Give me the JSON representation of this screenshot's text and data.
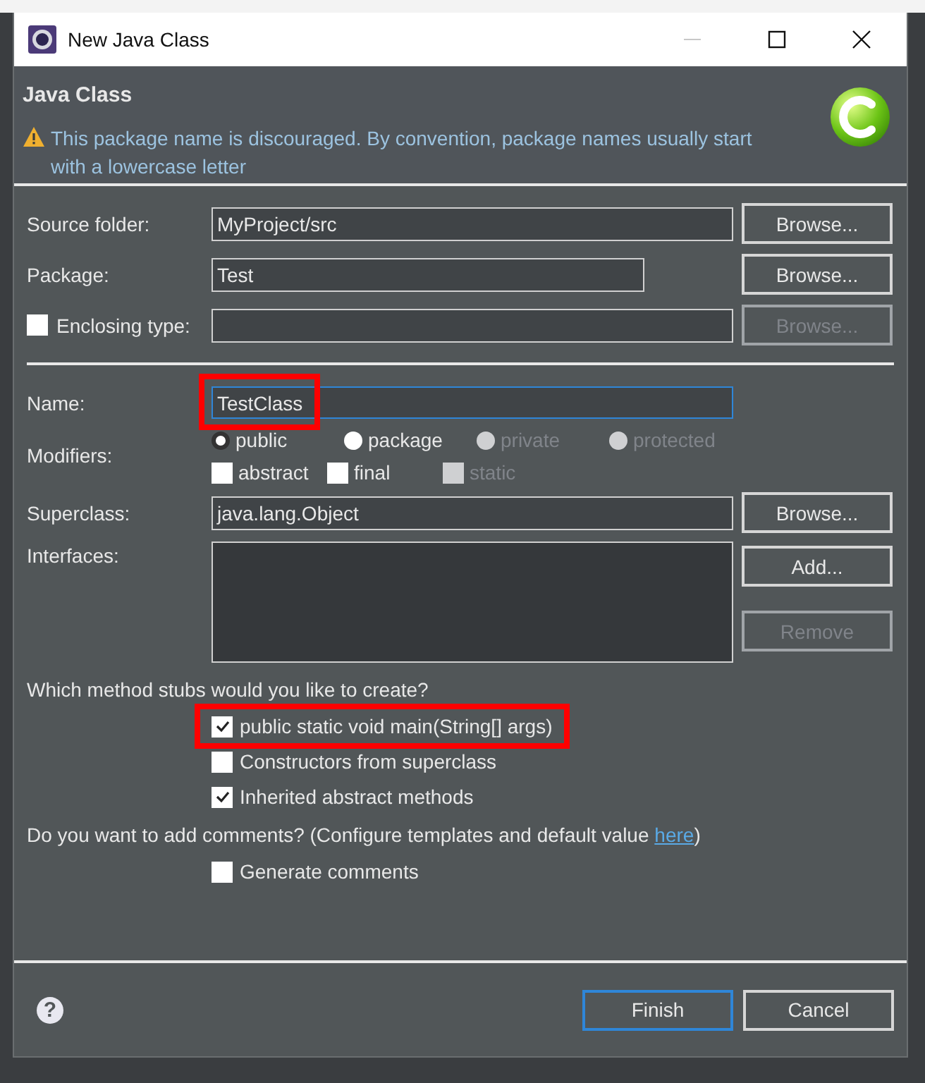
{
  "window": {
    "title": "New Java Class"
  },
  "header": {
    "title": "Java Class",
    "message": {
      "kind": "warning",
      "text": "This package name is discouraged. By convention, package names usually start with a lowercase letter"
    }
  },
  "top_fields": [
    {
      "kind": "text",
      "label": "Source folder:",
      "value": "MyProject/src",
      "button": {
        "label": "Browse...",
        "disabled": false
      }
    },
    {
      "kind": "short",
      "label": "Package:",
      "value": "Test",
      "button": {
        "label": "Browse...",
        "disabled": false
      }
    },
    {
      "kind": "checkbox",
      "label": "Enclosing type:",
      "checked": false,
      "button": {
        "label": "Browse...",
        "disabled": true
      }
    }
  ],
  "name": {
    "label": "Name:",
    "value": "TestClass",
    "highlighted": true
  },
  "modifiers": {
    "label": "Modifiers:",
    "radios": [
      {
        "label": "public",
        "selected": true,
        "disabled": false
      },
      {
        "label": "package",
        "selected": false,
        "disabled": false
      },
      {
        "label": "private",
        "selected": false,
        "disabled": true
      },
      {
        "label": "protected",
        "selected": false,
        "disabled": true
      }
    ],
    "checkboxes": [
      {
        "label": "abstract",
        "checked": false,
        "disabled": false
      },
      {
        "label": "final",
        "checked": false,
        "disabled": false
      },
      {
        "label": "static",
        "checked": false,
        "disabled": true
      }
    ]
  },
  "superclass": {
    "label": "Superclass:",
    "value": "java.lang.Object",
    "button": {
      "label": "Browse...",
      "disabled": false
    }
  },
  "interfaces": {
    "label": "Interfaces:",
    "buttons": [
      {
        "label": "Add...",
        "disabled": false
      },
      {
        "label": "Remove",
        "disabled": true
      }
    ]
  },
  "stubs": {
    "question": "Which method stubs would you like to create?",
    "options": [
      {
        "label": "public static void main(String[] args)",
        "checked": true,
        "highlighted": true
      },
      {
        "label": "Constructors from superclass",
        "checked": false,
        "highlighted": false
      },
      {
        "label": "Inherited abstract methods",
        "checked": true,
        "highlighted": false
      }
    ]
  },
  "comments": {
    "question": "Do you want to add comments? (Configure templates and default value ",
    "link": "here",
    "question_end": ")",
    "option": {
      "label": "Generate comments",
      "checked": false
    }
  },
  "footer": {
    "help": "?",
    "buttons": [
      {
        "label": "Finish",
        "default": true
      },
      {
        "label": "Cancel",
        "default": false
      }
    ]
  }
}
